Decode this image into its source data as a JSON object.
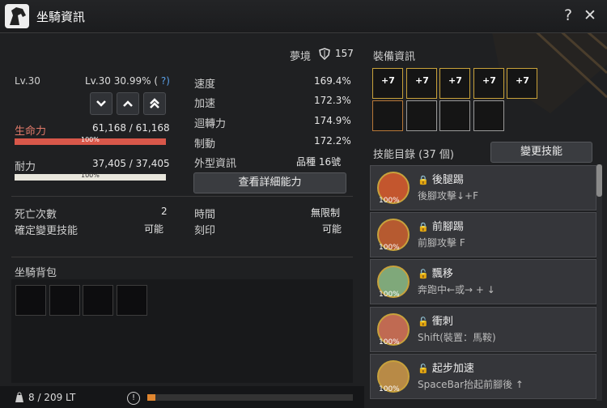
{
  "window": {
    "title": "坐騎資訊",
    "help": "?",
    "close": "✕"
  },
  "realm": {
    "label": "夢境",
    "value": "157"
  },
  "level": {
    "short": "Lv.30",
    "full": "Lv.30 30.99% (",
    "help": "?)"
  },
  "hp": {
    "label": "生命力",
    "value": "61,168 / 61,168",
    "pct": "100%"
  },
  "stamina": {
    "label": "耐力",
    "value": "37,405 / 37,405",
    "pct": "100%"
  },
  "stats": [
    {
      "label": "速度",
      "value": "169.4%"
    },
    {
      "label": "加速",
      "value": "172.3%"
    },
    {
      "label": "迴轉力",
      "value": "174.9%"
    },
    {
      "label": "制動",
      "value": "172.2%"
    }
  ],
  "appearance": {
    "label": "外型資訊",
    "value": "品種 16號"
  },
  "buttons": {
    "view_details": "查看詳細能力"
  },
  "misc": {
    "deaths_label": "死亡次數",
    "deaths_value": "2",
    "skill_change_label": "確定變更技能",
    "skill_change_value": "可能",
    "time_label": "時間",
    "time_value": "無限制",
    "imprint_label": "刻印",
    "imprint_value": "可能"
  },
  "inventory": {
    "title": "坐騎背包",
    "weight": "8 / 209 LT",
    "info_glyph": "!"
  },
  "equipment": {
    "title": "裝備資訊",
    "slots": [
      {
        "text": "+7"
      },
      {
        "text": "+7"
      },
      {
        "text": "+7"
      },
      {
        "text": "+7"
      },
      {
        "text": "+7"
      }
    ]
  },
  "skills": {
    "title": "技能目錄 (37 個)",
    "change_button": "變更技能",
    "list": [
      {
        "name": "後腿踢",
        "cmd": "後腳攻擊↓+F",
        "pct": "100%"
      },
      {
        "name": "前腳踢",
        "cmd": "前腳攻擊 F",
        "pct": "100%"
      },
      {
        "name": "飄移",
        "cmd": "奔跑中←或→ + ↓",
        "pct": "100%"
      },
      {
        "name": "衝刺",
        "cmd": "Shift(裝置：馬鞍)",
        "pct": "100%"
      },
      {
        "name": "起步加速",
        "cmd": "SpaceBar抬起前腳後 ↑",
        "pct": "100%"
      }
    ]
  }
}
